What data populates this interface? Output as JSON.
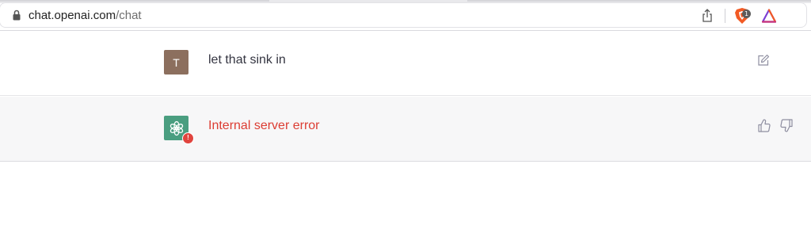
{
  "browser": {
    "url_host": "chat.openai.com",
    "url_path": "/chat",
    "brave_badge_count": "1",
    "icons": [
      "lock-icon",
      "share-icon",
      "brave-shield-icon",
      "brave-rewards-icon"
    ]
  },
  "conversation": {
    "user_message": {
      "avatar_letter": "T",
      "avatar_color": "#8c6f5e",
      "text": "let that sink in"
    },
    "assistant_message": {
      "avatar_color": "#4a9e80",
      "error_badge": "!",
      "text": "Internal server error",
      "text_color": "#dc3d33"
    }
  }
}
